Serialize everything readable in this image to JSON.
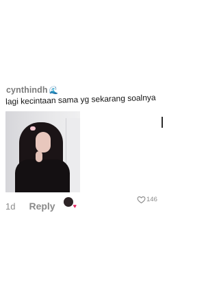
{
  "comment": {
    "username": "cynthindh",
    "username_icon": "wave-emoji-icon",
    "text": "lagi kecintaan sama yg sekarang soalnya",
    "timestamp": "1d",
    "reply_label": "Reply",
    "like_count": "146",
    "liked_by_creator": true
  },
  "colors": {
    "username": "#7b7b7b",
    "meta": "#8a8a8a",
    "heart_red": "#e0245e"
  }
}
